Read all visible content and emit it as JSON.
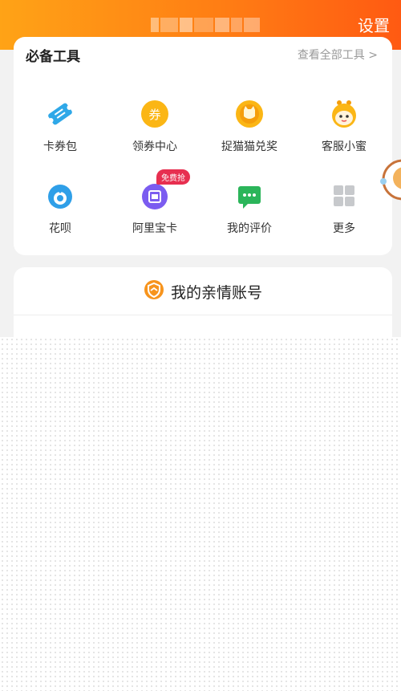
{
  "header": {
    "settings_label": "设置"
  },
  "tools": {
    "title": "必备工具",
    "view_all": "查看全部工具 >",
    "items": [
      {
        "label": "卡券包",
        "icon": "ticket-icon"
      },
      {
        "label": "领券中心",
        "icon": "coupon-icon",
        "glyph": "券"
      },
      {
        "label": "捉猫猫兑奖",
        "icon": "cat-coin-icon"
      },
      {
        "label": "客服小蜜",
        "icon": "bee-assistant-icon"
      },
      {
        "label": "花呗",
        "icon": "huabei-icon"
      },
      {
        "label": "阿里宝卡",
        "icon": "sim-card-icon",
        "badge": "免费抢"
      },
      {
        "label": "我的评价",
        "icon": "review-bubble-icon"
      },
      {
        "label": "更多",
        "icon": "grid-more-icon"
      }
    ]
  },
  "family": {
    "title": "我的亲情账号",
    "icon": "family-shield-icon"
  },
  "colors": {
    "header_start": "#ffa316",
    "header_end": "#ff5a12",
    "badge": "#e72f50"
  }
}
